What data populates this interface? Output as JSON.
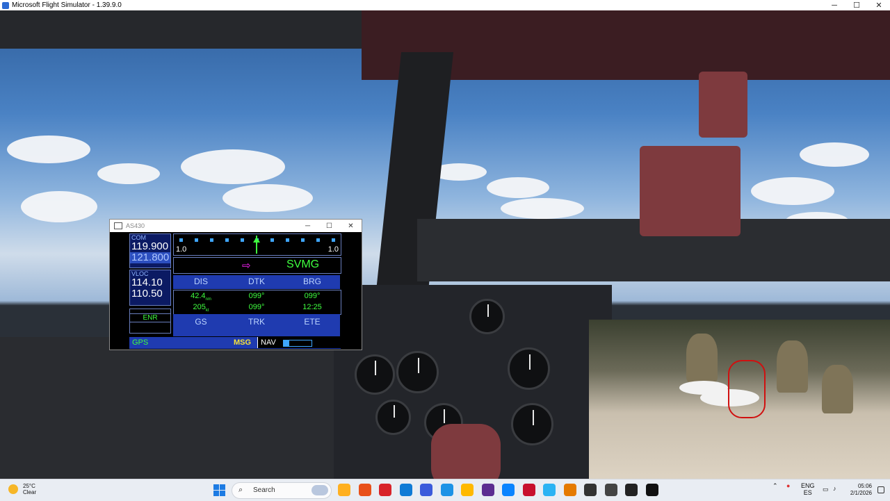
{
  "window": {
    "title": "Microsoft Flight Simulator - 1.39.9.0",
    "minimize": "─",
    "maximize": "☐",
    "close": "✕"
  },
  "as430": {
    "title": "AS430",
    "com": {
      "label": "COM",
      "active": "119.900",
      "standby": "121.800"
    },
    "vloc": {
      "label": "VLOC",
      "active": "114.10",
      "standby": "110.50"
    },
    "mode": "ENR",
    "cdi": {
      "scale_left": "1.0",
      "scale_right": "1.0"
    },
    "waypoint": {
      "arrow": "⇨",
      "name": "SVMG"
    },
    "fields": {
      "row1_labels": [
        "DIS",
        "DTK",
        "BRG"
      ],
      "row2_values": [
        "42.4",
        "099°",
        "099°"
      ],
      "row3_values": [
        "205",
        "099°",
        "12:25"
      ],
      "row4_labels": [
        "GS",
        "TRK",
        "ETE"
      ],
      "units": [
        "nm",
        "kt"
      ]
    },
    "status": {
      "gps": "GPS",
      "msg": "MSG",
      "nav": "NAV",
      "nav_progress": 0.2
    }
  },
  "taskbar": {
    "weather_temp": "25°C",
    "weather_desc": "Clear",
    "search_label": "Search",
    "search_icon": "search-icon",
    "lang_top": "ENG",
    "lang_bottom": "ES",
    "time": "05:06",
    "date": "2/1/2026",
    "colors": [
      "#ffb020",
      "#e8501a",
      "#d8232a",
      "#0f7bd6",
      "#3b5bdb",
      "#1d93e6",
      "#ffb900",
      "#5c2d91",
      "#0a84ff",
      "#c8102e",
      "#2bb3f3",
      "#e57a00",
      "#333",
      "#444",
      "#222",
      "#111"
    ]
  }
}
